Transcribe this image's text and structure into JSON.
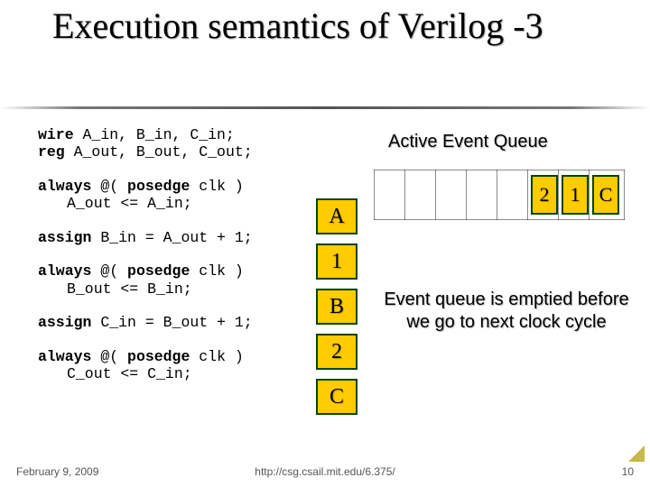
{
  "title": "Execution semantics of Verilog -3",
  "code": {
    "l1a": "wire",
    "l1b": " A_in, B_in, C_in;",
    "l2a": "reg",
    "l2b": "  A_out, B_out, C_out;",
    "b1a": "always",
    "b1b": " @(",
    "b1c": " posedge",
    "b1d": " clk )",
    "b1e": "A_out <= A_in;",
    "a1a": "assign",
    "a1b": " B_in = A_out + 1;",
    "b2a": "always",
    "b2b": " @(",
    "b2c": " posedge",
    "b2d": " clk )",
    "b2e": "B_out <= B_in;",
    "a2a": "assign",
    "a2b": " C_in = B_out + 1;",
    "b3a": "always",
    "b3b": " @(",
    "b3c": " posedge",
    "b3d": " clk )",
    "b3e": "C_out <= C_in;"
  },
  "boxes": [
    "A",
    "1",
    "B",
    "2",
    "C"
  ],
  "aeq_label": "Active Event Queue",
  "queue_slots": [
    "2",
    "1",
    "C"
  ],
  "description": "Event queue is emptied before we go to next clock cycle",
  "footer": {
    "left": "February 9, 2009",
    "center": "http://csg.csail.mit.edu/6.375/",
    "right": "10"
  }
}
